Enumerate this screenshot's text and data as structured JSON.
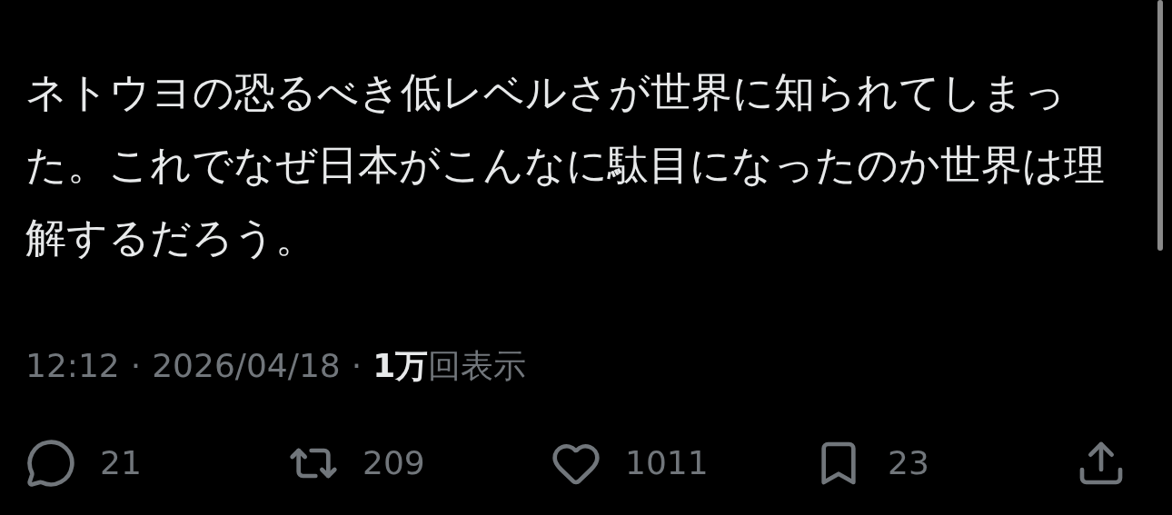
{
  "post": {
    "text": "ネトウヨの恐るべき低レベルさが世界に知られてしまった。これでなぜ日本がこんなに駄目になったのか世界は理解するだろう。"
  },
  "meta": {
    "time": "12:12",
    "separator_1": "·",
    "date": "2026/04/18",
    "separator_2": "·",
    "views": "1万",
    "views_label": "回表示"
  },
  "actions": [
    {
      "kind": "reply",
      "count": "21"
    },
    {
      "kind": "repost",
      "count": "209"
    },
    {
      "kind": "like",
      "count": "1011"
    },
    {
      "kind": "bookmark",
      "count": "23"
    },
    {
      "kind": "share"
    }
  ]
}
